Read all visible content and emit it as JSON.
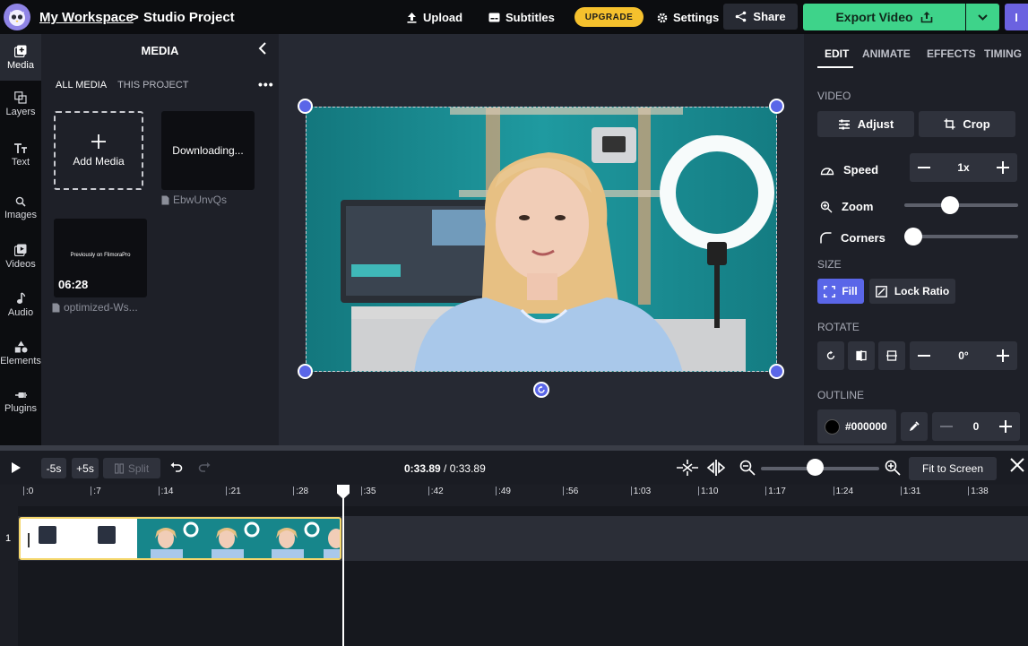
{
  "header": {
    "workspace_link": "My Workspace",
    "separator": ">",
    "project_name": "Studio Project",
    "upload_label": "Upload",
    "subtitles_label": "Subtitles",
    "upgrade_label": "UPGRADE",
    "settings_label": "Settings",
    "share_label": "Share",
    "export_label": "Export Video",
    "user_initial": "I"
  },
  "rail": {
    "items": [
      {
        "label": "Media",
        "icon": "media-icon"
      },
      {
        "label": "Layers",
        "icon": "layers-icon"
      },
      {
        "label": "Text",
        "icon": "text-icon"
      },
      {
        "label": "Images",
        "icon": "search-icon"
      },
      {
        "label": "Videos",
        "icon": "videos-icon"
      },
      {
        "label": "Audio",
        "icon": "audio-icon"
      },
      {
        "label": "Elements",
        "icon": "elements-icon"
      },
      {
        "label": "Plugins",
        "icon": "plugins-icon"
      }
    ]
  },
  "media": {
    "title": "MEDIA",
    "tabs": [
      "ALL MEDIA",
      "THIS PROJECT"
    ],
    "more": "•••",
    "add_media_label": "Add Media",
    "items": [
      {
        "thumb_text": "Downloading...",
        "name": "EbwUnvQs"
      },
      {
        "thumb_text": "Previously on FlimoraPro",
        "duration": "06:28",
        "name": "optimized-Ws..."
      }
    ]
  },
  "props": {
    "tabs": [
      "EDIT",
      "ANIMATE",
      "EFFECTS",
      "TIMING"
    ],
    "video_section": "VIDEO",
    "adjust_label": "Adjust",
    "crop_label": "Crop",
    "speed_label": "Speed",
    "speed_value": "1x",
    "zoom_label": "Zoom",
    "zoom_level": 0.38,
    "corners_label": "Corners",
    "corners_level": 0.0,
    "size_section": "SIZE",
    "fill_label": "Fill",
    "lock_ratio_label": "Lock Ratio",
    "rotate_section": "ROTATE",
    "rotate_value": "0°",
    "outline_section": "OUTLINE",
    "outline_color": "#000000",
    "outline_width": "0"
  },
  "timeline": {
    "back_label": "-5s",
    "forward_label": "+5s",
    "split_label": "Split",
    "current_time": "0:33.89",
    "total_time": "0:33.89",
    "time_sep": "/",
    "fit_label": "Fit to Screen",
    "zoom_level": 0.45,
    "track_number": "1",
    "ticks": [
      ":0",
      ":7",
      ":14",
      ":21",
      ":28",
      ":35",
      ":42",
      ":49",
      ":56",
      "1:03",
      "1:10",
      "1:17",
      "1:24",
      "1:31",
      "1:38"
    ]
  },
  "colors": {
    "accent": "#5a66e8",
    "export_green": "#3ed38a",
    "upgrade_yellow": "#f6c12d",
    "clip_border": "#f4d66c"
  }
}
